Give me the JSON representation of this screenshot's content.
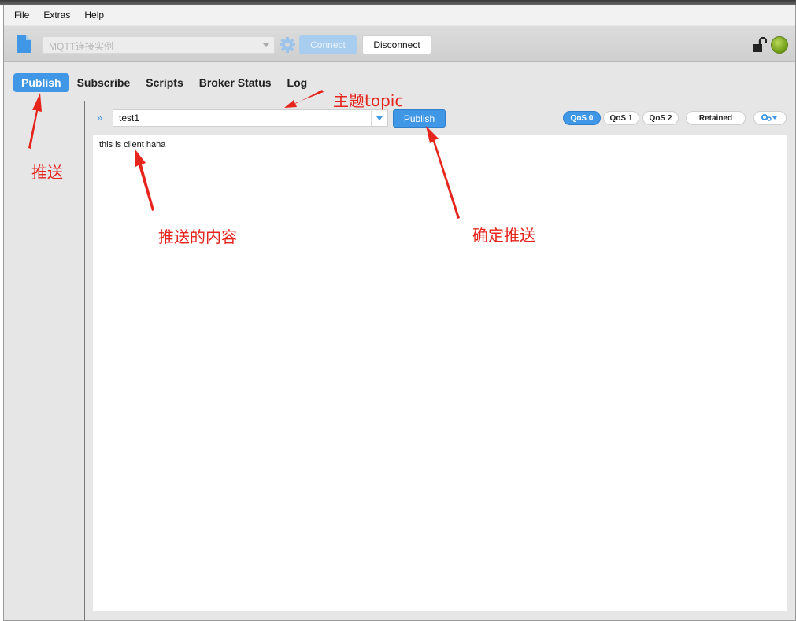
{
  "menubar": {
    "items": [
      "File",
      "Extras",
      "Help"
    ]
  },
  "toolbar": {
    "connection_profile": "MQTT连接实例",
    "connect_label": "Connect",
    "disconnect_label": "Disconnect"
  },
  "tabs": [
    {
      "label": "Publish",
      "active": true
    },
    {
      "label": "Subscribe",
      "active": false
    },
    {
      "label": "Scripts",
      "active": false
    },
    {
      "label": "Broker Status",
      "active": false
    },
    {
      "label": "Log",
      "active": false
    }
  ],
  "publish": {
    "topic_value": "test1",
    "publish_label": "Publish",
    "qos_options": [
      "QoS 0",
      "QoS 1",
      "QoS 2"
    ],
    "qos_selected": "QoS 0",
    "retained_label": "Retained",
    "payload": "this is client haha"
  },
  "annotations": {
    "topic": "主题topic",
    "publish_tab": "推送",
    "payload": "推送的内容",
    "confirm": "确定推送"
  },
  "colors": {
    "accent": "#3f97e6",
    "annotation": "#e5241c",
    "status_connected": "#7aa51c"
  },
  "icons": [
    "file-icon",
    "gear-icon",
    "lock-icon",
    "expand-icon",
    "options-icon"
  ]
}
